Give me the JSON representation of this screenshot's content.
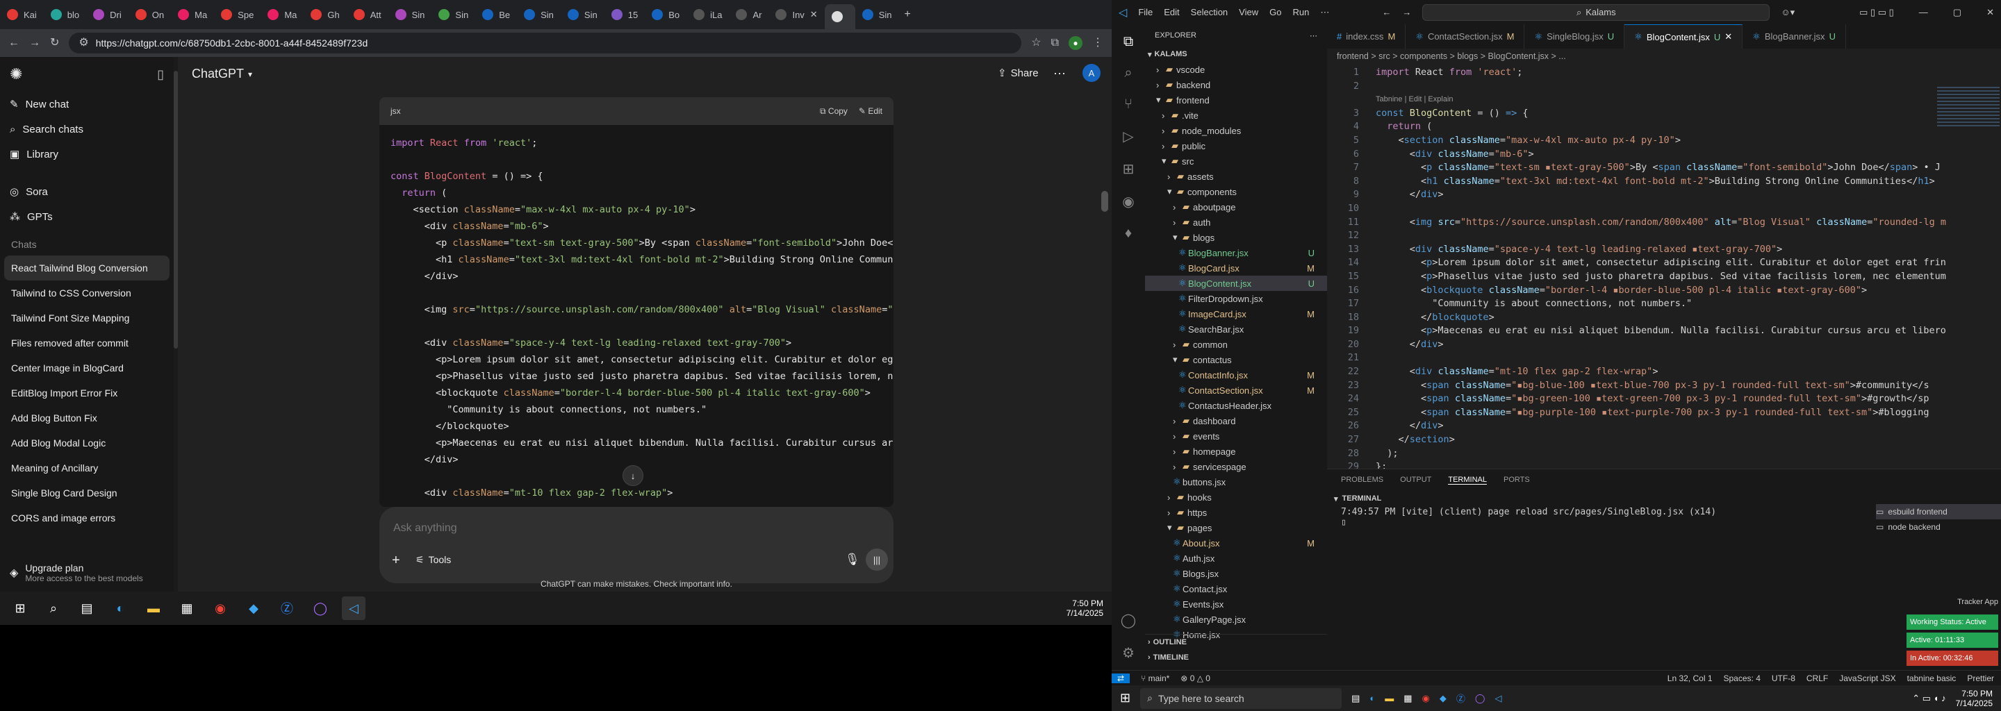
{
  "colors": {
    "accent": "#0078d4",
    "gpt_bg": "#212121",
    "vs_bg": "#1e1e1e",
    "green_status": "#23a455",
    "red_status": "#c0392b"
  },
  "browser": {
    "tabs": [
      "Kai",
      "blo",
      "Dri",
      "On",
      "Ma",
      "Spe",
      "Ma",
      "Gh",
      "Att",
      "Sin",
      "Sin",
      "Be",
      "Sin",
      "Sin",
      "15",
      "Bo",
      "iLa",
      "Ar",
      "Inv",
      "",
      "Sin"
    ],
    "url": "https://chatgpt.com/c/68750db1-2cbc-8001-a44f-8452489f723d"
  },
  "gpt": {
    "model": "ChatGPT",
    "share": "Share",
    "avatar": "A",
    "sidebar": {
      "new_chat": "New chat",
      "search": "Search chats",
      "library": "Library",
      "sora": "Sora",
      "gpts": "GPTs",
      "chats_header": "Chats",
      "chats": [
        "React Tailwind Blog Conversion",
        "Tailwind to CSS Conversion",
        "Tailwind Font Size Mapping",
        "Files removed after commit",
        "Center Image in BlogCard",
        "EditBlog Import Error Fix",
        "Add Blog Button Fix",
        "Add Blog Modal Logic",
        "Meaning of Ancillary",
        "Single Blog Card Design",
        "CORS and image errors"
      ],
      "upgrade": "Upgrade plan",
      "upgrade_sub": "More access to the best models"
    },
    "code": {
      "lang": "jsx",
      "copy": "Copy",
      "edit": "Edit"
    },
    "prompt": {
      "placeholder": "Ask anything",
      "tools": "Tools"
    },
    "disclaimer": "ChatGPT can make mistakes. Check important info."
  },
  "taskbar_left": {
    "time": "7:50 PM",
    "date": "7/14/2025"
  },
  "vscode": {
    "menu": [
      "File",
      "Edit",
      "Selection",
      "View",
      "Go",
      "Run"
    ],
    "search": "Kalams",
    "explorer_title": "EXPLORER",
    "root": "KALAMS",
    "tabs": [
      {
        "label": "index.css",
        "badge": "M"
      },
      {
        "label": "ContactSection.jsx",
        "badge": "M"
      },
      {
        "label": "SingleBlog.jsx",
        "badge": "U"
      },
      {
        "label": "BlogContent.jsx",
        "badge": "U"
      },
      {
        "label": "BlogBanner.jsx",
        "badge": "U"
      }
    ],
    "breadcrumb": "frontend > src > components > blogs > BlogContent.jsx > ...",
    "tabnine": "Tabnine | Edit | Explain",
    "tree": [
      {
        "n": "vscode",
        "l": 1,
        "b": ""
      },
      {
        "n": "backend",
        "l": 1,
        "b": ""
      },
      {
        "n": "frontend",
        "l": 1,
        "b": ""
      },
      {
        "n": ".vite",
        "l": 2,
        "b": ""
      },
      {
        "n": "node_modules",
        "l": 2,
        "b": ""
      },
      {
        "n": "public",
        "l": 2,
        "b": ""
      },
      {
        "n": "src",
        "l": 2,
        "b": ""
      },
      {
        "n": "assets",
        "l": 3,
        "b": ""
      },
      {
        "n": "components",
        "l": 3,
        "b": ""
      },
      {
        "n": "aboutpage",
        "l": 4,
        "b": ""
      },
      {
        "n": "auth",
        "l": 4,
        "b": ""
      },
      {
        "n": "blogs",
        "l": 4,
        "b": ""
      },
      {
        "n": "BlogBanner.jsx",
        "l": 5,
        "b": "U"
      },
      {
        "n": "BlogCard.jsx",
        "l": 5,
        "b": "M"
      },
      {
        "n": "BlogContent.jsx",
        "l": 5,
        "b": "U"
      },
      {
        "n": "FilterDropdown.jsx",
        "l": 5,
        "b": ""
      },
      {
        "n": "ImageCard.jsx",
        "l": 5,
        "b": "M"
      },
      {
        "n": "SearchBar.jsx",
        "l": 5,
        "b": ""
      },
      {
        "n": "common",
        "l": 4,
        "b": ""
      },
      {
        "n": "contactus",
        "l": 4,
        "b": ""
      },
      {
        "n": "ContactInfo.jsx",
        "l": 5,
        "b": "M"
      },
      {
        "n": "ContactSection.jsx",
        "l": 5,
        "b": "M"
      },
      {
        "n": "ContactusHeader.jsx",
        "l": 5,
        "b": ""
      },
      {
        "n": "dashboard",
        "l": 4,
        "b": ""
      },
      {
        "n": "events",
        "l": 4,
        "b": ""
      },
      {
        "n": "homepage",
        "l": 4,
        "b": ""
      },
      {
        "n": "servicespage",
        "l": 4,
        "b": ""
      },
      {
        "n": "buttons.jsx",
        "l": 4,
        "b": ""
      },
      {
        "n": "hooks",
        "l": 3,
        "b": ""
      },
      {
        "n": "https",
        "l": 3,
        "b": ""
      },
      {
        "n": "pages",
        "l": 3,
        "b": ""
      },
      {
        "n": "About.jsx",
        "l": 4,
        "b": "M"
      },
      {
        "n": "Auth.jsx",
        "l": 4,
        "b": ""
      },
      {
        "n": "Blogs.jsx",
        "l": 4,
        "b": ""
      },
      {
        "n": "Contact.jsx",
        "l": 4,
        "b": ""
      },
      {
        "n": "Events.jsx",
        "l": 4,
        "b": ""
      },
      {
        "n": "GalleryPage.jsx",
        "l": 4,
        "b": ""
      },
      {
        "n": "Home.jsx",
        "l": 4,
        "b": ""
      }
    ],
    "outline": "OUTLINE",
    "timeline": "TIMELINE",
    "panel_tabs": [
      "PROBLEMS",
      "OUTPUT",
      "TERMINAL",
      "PORTS"
    ],
    "terminal_label": "TERMINAL",
    "terminal_line": "7:49:57 PM [vite] (client) page reload src/pages/SingleBlog.jsx (x14)",
    "terminals": [
      "esbuild frontend",
      "node backend"
    ],
    "tracker": {
      "title": "Tracker App",
      "working": "Working Status: Active",
      "active": "Active: 01:11:33",
      "inactive": "In Active: 00:32:46"
    },
    "status": {
      "branch": "main*",
      "errors": "0 △ 0",
      "pos": "Ln 32, Col 1",
      "spaces": "Spaces: 4",
      "enc": "UTF-8",
      "eol": "CRLF",
      "lang": "JavaScript JSX",
      "tabnine": "tabnine basic",
      "prettier": "Prettier"
    },
    "search_placeholder": "Type here to search",
    "time": "7:50 PM",
    "date": "7/14/2025"
  }
}
